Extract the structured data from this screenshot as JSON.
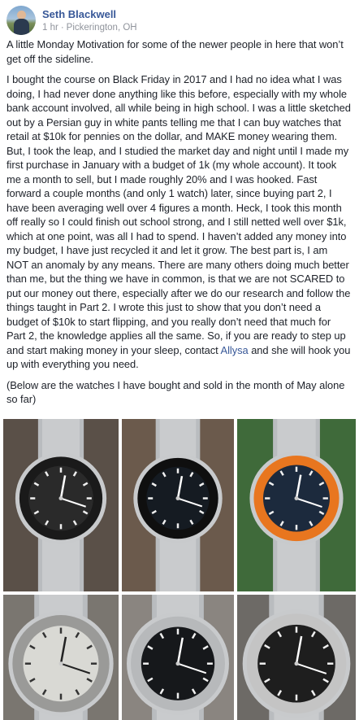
{
  "post": {
    "author": "Seth Blackwell",
    "time": "1 hr",
    "separator": "·",
    "location": "Pickerington, OH",
    "paragraph1": "A little Monday Motivation for some of the newer people in here that won’t get off the sideline.",
    "paragraph2_before_mention": "I bought the course on Black Friday in 2017 and I had no idea what I was doing, I had never done anything like this before, especially with my whole bank account involved, all while being in high school. I was a little sketched out by a Persian guy in white pants telling me that I can buy watches that retail at $10k for pennies on the dollar, and MAKE money wearing them. But, I took the leap, and I studied the market day and night until I made my first purchase in January with a budget of 1k (my whole account). It took me a month to sell, but I made roughly 20% and I was hooked. Fast forward a couple months (and only 1 watch) later, since buying part 2, I have been averaging well over 4 figures a month. Heck, I took this month off really so I could finish out school strong, and I still netted well over $1k, which at one point, was all I had to spend. I haven’t added any money into my budget, I have just recycled it and let it grow. The best part is, I am NOT an anomaly by any means. There are many others doing much better than me, but the thing we have in common, is that we are not SCARED to put our money out there, especially after we do our research and follow the things taught in Part 2. I wrote this just to show that you don’t need a budget of $10k to start flipping, and you really don’t need that much for Part 2, the knowledge applies all the same. So, if you are ready to step up and start making money in your sleep, contact",
    "mention": "Allysa",
    "paragraph2_after_mention": "and she will hook you up with everything you need.",
    "paragraph3": "(Below are the watches I have bought and sold in the month of May alone so far)"
  },
  "photos": [
    {
      "name": "watch-photo-1",
      "dial": "#2a2a2a",
      "bezel": "#1a1a1a"
    },
    {
      "name": "watch-photo-2",
      "dial": "#151b22",
      "bezel": "#0f0f0f"
    },
    {
      "name": "watch-photo-3",
      "dial": "#1c2a3d",
      "bezel": "#e8761f"
    },
    {
      "name": "watch-photo-4",
      "dial": "#d9d9d4",
      "bezel": "#9a9a98"
    },
    {
      "name": "watch-photo-5",
      "dial": "#16181b",
      "bezel": "#b7b9bb"
    },
    {
      "name": "watch-photo-6",
      "dial": "#1e1e1e",
      "bezel": "#c4c4c4"
    }
  ],
  "colors": {
    "link": "#385898",
    "text": "#1d2129",
    "muted": "#90949c"
  }
}
